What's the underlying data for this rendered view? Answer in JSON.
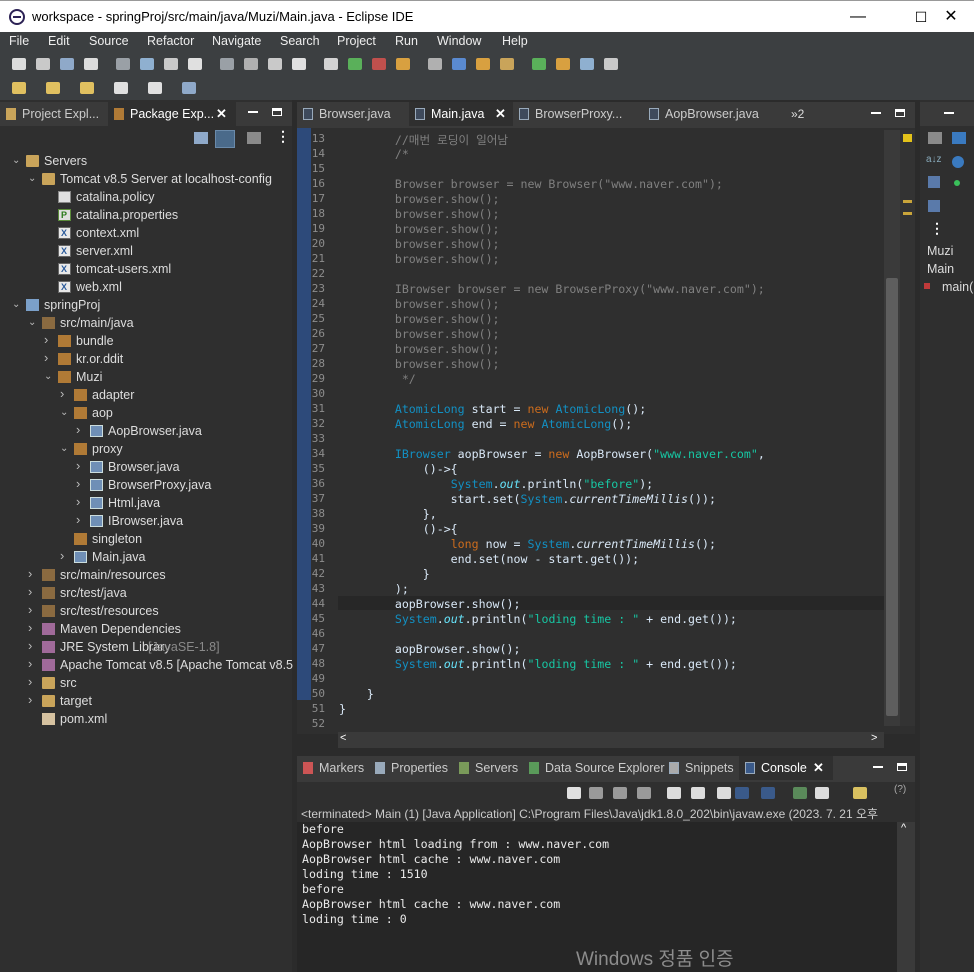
{
  "window": {
    "title": "workspace - springProj/src/main/java/Muzi/Main.java - Eclipse IDE",
    "minimize": "—",
    "maximize": "☐",
    "close": "✕"
  },
  "menu": [
    "File",
    "Edit",
    "Source",
    "Refactor",
    "Navigate",
    "Search",
    "Project",
    "Run",
    "Window",
    "Help"
  ],
  "left_panel": {
    "tabs": [
      {
        "label": "Project Expl..."
      },
      {
        "label": "Package Exp..."
      }
    ],
    "tree": [
      {
        "label": "Servers",
        "icon": "folder",
        "depth": 0,
        "open": true
      },
      {
        "label": "Tomcat v8.5 Server at localhost-config",
        "icon": "folder",
        "depth": 1,
        "open": true
      },
      {
        "label": "catalina.policy",
        "icon": "file",
        "depth": 2
      },
      {
        "label": "catalina.properties",
        "icon": "props",
        "depth": 2
      },
      {
        "label": "context.xml",
        "icon": "xml",
        "depth": 2
      },
      {
        "label": "server.xml",
        "icon": "xml",
        "depth": 2
      },
      {
        "label": "tomcat-users.xml",
        "icon": "xml",
        "depth": 2
      },
      {
        "label": "web.xml",
        "icon": "xml",
        "depth": 2
      },
      {
        "label": "springProj",
        "icon": "proj",
        "depth": 0,
        "open": true
      },
      {
        "label": "src/main/java",
        "icon": "jar",
        "depth": 1,
        "open": true
      },
      {
        "label": "bundle",
        "icon": "pkg",
        "depth": 2,
        "open": false
      },
      {
        "label": "kr.or.ddit",
        "icon": "pkg",
        "depth": 2,
        "open": false
      },
      {
        "label": "Muzi",
        "icon": "pkg",
        "depth": 2,
        "open": true
      },
      {
        "label": "adapter",
        "icon": "pkg",
        "depth": 3,
        "open": false
      },
      {
        "label": "aop",
        "icon": "pkg",
        "depth": 3,
        "open": true
      },
      {
        "label": "AopBrowser.java",
        "icon": "java",
        "depth": 4,
        "open": false
      },
      {
        "label": "proxy",
        "icon": "pkg",
        "depth": 3,
        "open": true
      },
      {
        "label": "Browser.java",
        "icon": "java",
        "depth": 4,
        "open": false
      },
      {
        "label": "BrowserProxy.java",
        "icon": "java",
        "depth": 4,
        "open": false
      },
      {
        "label": "Html.java",
        "icon": "java",
        "depth": 4,
        "open": false
      },
      {
        "label": "IBrowser.java",
        "icon": "java",
        "depth": 4,
        "open": false
      },
      {
        "label": "singleton",
        "icon": "pkg",
        "depth": 3
      },
      {
        "label": "Main.java",
        "icon": "java",
        "depth": 3,
        "open": false
      },
      {
        "label": "src/main/resources",
        "icon": "jar",
        "depth": 1,
        "open": false
      },
      {
        "label": "src/test/java",
        "icon": "jar",
        "depth": 1,
        "open": false
      },
      {
        "label": "src/test/resources",
        "icon": "jar",
        "depth": 1,
        "open": false
      },
      {
        "label": "Maven Dependencies",
        "icon": "maven",
        "depth": 1,
        "open": false
      },
      {
        "label": "JRE System Library",
        "decoration": "[JavaSE-1.8]",
        "icon": "maven",
        "depth": 1,
        "open": false
      },
      {
        "label": "Apache Tomcat v8.5 [Apache Tomcat v8.5",
        "icon": "maven",
        "depth": 1,
        "open": false
      },
      {
        "label": "src",
        "icon": "folder",
        "depth": 1,
        "open": false
      },
      {
        "label": "target",
        "icon": "folder",
        "depth": 1,
        "open": false
      },
      {
        "label": "pom.xml",
        "icon": "pom",
        "depth": 1
      }
    ]
  },
  "editor": {
    "tabs": [
      {
        "label": "Browser.java"
      },
      {
        "label": "Main.java"
      },
      {
        "label": "BrowserProxy..."
      },
      {
        "label": "AopBrowser.java"
      }
    ],
    "overflow": "»2",
    "line_numbers": [
      "13",
      "14",
      "15",
      "16",
      "17",
      "18",
      "19",
      "20",
      "21",
      "22",
      "23",
      "24",
      "25",
      "26",
      "27",
      "28",
      "29",
      "30",
      "31",
      "32",
      "33",
      "34",
      "35",
      "36",
      "37",
      "38",
      "39",
      "40",
      "41",
      "42",
      "43",
      "44",
      "45",
      "46",
      "47",
      "48",
      "49",
      "50",
      "51",
      "52"
    ],
    "lines": [
      [
        [
          "cm",
          "        //매번 로딩이 일어남"
        ]
      ],
      [
        [
          "cm",
          "        /*"
        ]
      ],
      [],
      [
        [
          "cm",
          "        Browser browser = new Browser(\"www.naver.com\");"
        ]
      ],
      [
        [
          "cm",
          "        browser.show();"
        ]
      ],
      [
        [
          "cm",
          "        browser.show();"
        ]
      ],
      [
        [
          "cm",
          "        browser.show();"
        ]
      ],
      [
        [
          "cm",
          "        browser.show();"
        ]
      ],
      [
        [
          "cm",
          "        browser.show();"
        ]
      ],
      [],
      [
        [
          "cm",
          "        IBrowser browser = new BrowserProxy(\"www.naver.com\");"
        ]
      ],
      [
        [
          "cm",
          "        browser.show();"
        ]
      ],
      [
        [
          "cm",
          "        browser.show();"
        ]
      ],
      [
        [
          "cm",
          "        browser.show();"
        ]
      ],
      [
        [
          "cm",
          "        browser.show();"
        ]
      ],
      [
        [
          "cm",
          "        browser.show();"
        ]
      ],
      [
        [
          "cm",
          "         */"
        ]
      ],
      [],
      [
        [
          "",
          "        "
        ],
        [
          "ty",
          "AtomicLong"
        ],
        [
          "",
          " "
        ],
        [
          "",
          "start"
        ],
        [
          "",
          " = "
        ],
        [
          "kw",
          "new"
        ],
        [
          "",
          " "
        ],
        [
          "ty",
          "AtomicLong"
        ],
        [
          "",
          "();"
        ]
      ],
      [
        [
          "",
          "        "
        ],
        [
          "ty",
          "AtomicLong"
        ],
        [
          "",
          " end = "
        ],
        [
          "kw",
          "new"
        ],
        [
          "",
          " "
        ],
        [
          "ty",
          "AtomicLong"
        ],
        [
          "",
          "();"
        ]
      ],
      [],
      [
        [
          "",
          "        "
        ],
        [
          "ty",
          "IBrowser"
        ],
        [
          "",
          " aopBrowser = "
        ],
        [
          "kw",
          "new"
        ],
        [
          "",
          " AopBrowser("
        ],
        [
          "st",
          "\"www.naver.com\""
        ],
        [
          "",
          ","
        ]
      ],
      [
        [
          "",
          "            ()->{"
        ]
      ],
      [
        [
          "",
          "                "
        ],
        [
          "ty",
          "System"
        ],
        [
          "",
          "."
        ],
        [
          "fd",
          "out"
        ],
        [
          "",
          ".println("
        ],
        [
          "st",
          "\"before\""
        ],
        [
          "",
          ");"
        ]
      ],
      [
        [
          "",
          "                start.set("
        ],
        [
          "ty",
          "System"
        ],
        [
          "",
          "."
        ],
        [
          "it",
          "currentTimeMillis"
        ],
        [
          "",
          "());"
        ]
      ],
      [
        [
          "",
          "            },"
        ]
      ],
      [
        [
          "",
          "            ()->{"
        ]
      ],
      [
        [
          "",
          "                "
        ],
        [
          "kw",
          "long"
        ],
        [
          "",
          " now = "
        ],
        [
          "ty",
          "System"
        ],
        [
          "",
          "."
        ],
        [
          "it",
          "currentTimeMillis"
        ],
        [
          "",
          "();"
        ]
      ],
      [
        [
          "",
          "                end.set(now - start.get());"
        ]
      ],
      [
        [
          "",
          "            }"
        ]
      ],
      [
        [
          "",
          "        );"
        ]
      ],
      [
        [
          "",
          "        aopBrowser.show();"
        ]
      ],
      [
        [
          "",
          "        "
        ],
        [
          "ty",
          "System"
        ],
        [
          "",
          "."
        ],
        [
          "fd",
          "out"
        ],
        [
          "",
          ".println("
        ],
        [
          "st",
          "\"loding time : \""
        ],
        [
          "",
          " + end.get());"
        ]
      ],
      [],
      [
        [
          "",
          "        aopBrowser.show();"
        ]
      ],
      [
        [
          "",
          "        "
        ],
        [
          "ty",
          "System"
        ],
        [
          "",
          "."
        ],
        [
          "fd",
          "out"
        ],
        [
          "",
          ".println("
        ],
        [
          "st",
          "\"loding time : \""
        ],
        [
          "",
          " + end.get());"
        ]
      ],
      [],
      [
        [
          "",
          "    }"
        ]
      ],
      [
        [
          "",
          "}"
        ]
      ],
      []
    ]
  },
  "bottom_panel": {
    "tabs": [
      {
        "label": "Markers"
      },
      {
        "label": "Properties"
      },
      {
        "label": "Servers"
      },
      {
        "label": "Data Source Explorer"
      },
      {
        "label": "Snippets"
      },
      {
        "label": "Console"
      }
    ],
    "status": "<terminated> Main (1) [Java Application] C:\\Program Files\\Java\\jdk1.8.0_202\\bin\\javaw.exe  (2023. 7. 21 오후",
    "output": [
      "before",
      "AopBrowser html loading from : www.naver.com",
      "AopBrowser html cache : www.naver.com",
      "loding time : 1510",
      "before",
      "AopBrowser html cache : www.naver.com",
      "loding time : 0"
    ],
    "help": "(?)"
  },
  "outline": {
    "items": [
      "Muzi",
      "Main",
      "main("
    ]
  },
  "watermark": "Windows 정품 인증"
}
